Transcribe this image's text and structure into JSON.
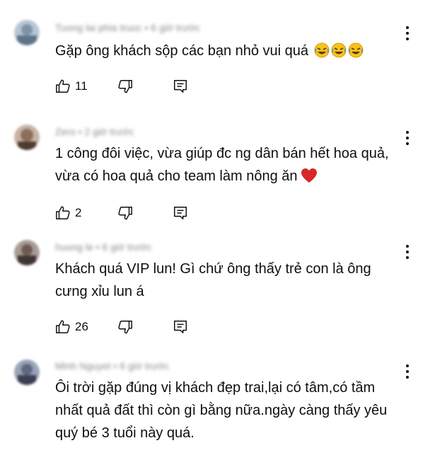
{
  "comments": [
    {
      "author": "Tuong lai phia truoc",
      "time": "6 giờ trước",
      "text": "Gặp ông khách sộp các bạn nhỏ vui quá",
      "emojis": [
        "rolling-on-floor-laughing",
        "rolling-on-floor-laughing",
        "rolling-on-floor-laughing"
      ],
      "likes": "11"
    },
    {
      "author": "Zero",
      "time": "2 giờ trước",
      "text": "1 công đôi việc, vừa giúp đc ng dân bán hết hoa quả, vừa có hoa quả cho team làm nông ăn",
      "emojis": [
        "red-heart"
      ],
      "likes": "2"
    },
    {
      "author": "huong le",
      "time": "6 giờ trước",
      "text": "Khách quá VIP lun! Gì chứ ông thấy trẻ con là ông cưng xỉu lun á",
      "emojis": [],
      "likes": "26"
    },
    {
      "author": "Minh Nguyet",
      "time": "6 giờ trước",
      "text": "Ôi trời gặp đúng vị khách đẹp trai,lại có tâm,có tầm nhất quả đất thì còn gì bằng nữa.ngày càng thấy yêu quý bé 3 tuổi này quá.",
      "emojis": [],
      "likes": ""
    }
  ],
  "meta_separator": " • ",
  "icons": {
    "like": "thumbs-up-icon",
    "dislike": "thumbs-down-icon",
    "reply": "reply-icon",
    "menu": "more-vert-icon"
  },
  "colors": {
    "text": "#0f0f0f",
    "meta": "#8a8a8a",
    "heart": "#d62828",
    "emoji": "#f8c21c"
  }
}
